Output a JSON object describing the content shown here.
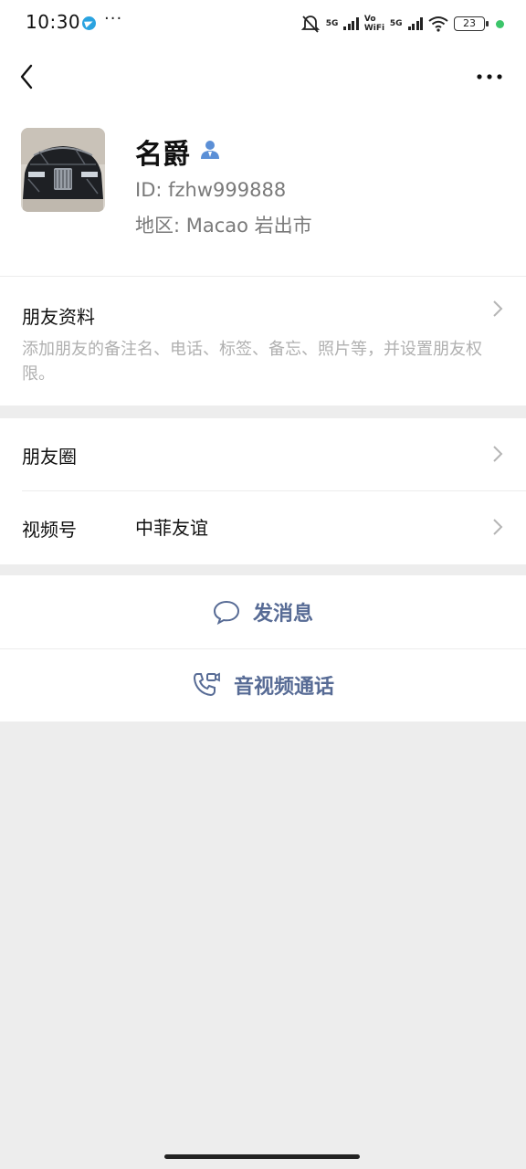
{
  "status_bar": {
    "time": "10:30",
    "telegram_icon": "telegram-icon",
    "dots": "···",
    "sig1_label": "5G",
    "volte_label": "Vo WiFi",
    "sig2_label": "5G",
    "battery": "23"
  },
  "nav": {
    "back_icon": "chevron-left-icon",
    "more_icon": "more-dots-icon"
  },
  "profile": {
    "name": "名爵",
    "id_text": "ID:  fzhw999888",
    "region_text": "地区:  Macao  岩出市"
  },
  "friend_info": {
    "title": "朋友资料",
    "description": "添加朋友的备注名、电话、标签、备忘、照片等，并设置朋友权限。"
  },
  "moments": {
    "label": "朋友圈"
  },
  "channels": {
    "label": "视频号",
    "value": "中菲友谊"
  },
  "actions": {
    "message_label": "发消息",
    "call_label": "音视频通话"
  },
  "colors": {
    "link_blue": "#576b95",
    "page_gray": "#ededed",
    "secondary_text": "#7a7a7a"
  }
}
